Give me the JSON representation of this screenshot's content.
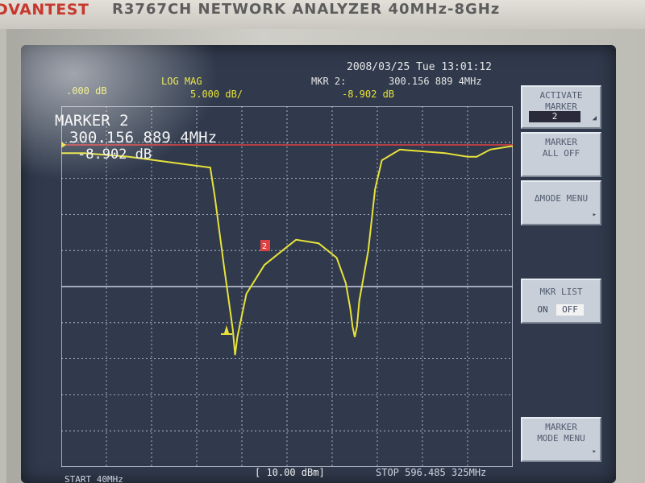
{
  "instrument": {
    "brand": "DVANTEST",
    "model": "R3767CH  NETWORK  ANALYZER  40MHz-8GHz"
  },
  "header": {
    "datetime": "2008/03/25 Tue 13:01:12",
    "format": "LOG MAG",
    "ref_value": ".000 dB",
    "scale": "5.000 dB/",
    "marker_label": "MKR  2:",
    "marker_freq": "300.156 889 4MHz",
    "marker_value": "-8.902 dB"
  },
  "marker_readout": {
    "title": "MARKER 2",
    "freq": "300.156  889  4MHz",
    "value": "-8.902 dB"
  },
  "trace_color": "#e8e23a",
  "grid_color": "#c9cfe0",
  "ref_line_color": "#e04040",
  "trace_norm": [
    [
      0,
      0.13
    ],
    [
      0.05,
      0.13
    ],
    [
      0.15,
      0.14
    ],
    [
      0.27,
      0.16
    ],
    [
      0.33,
      0.17
    ],
    [
      0.34,
      0.25
    ],
    [
      0.36,
      0.44
    ],
    [
      0.38,
      0.62
    ],
    [
      0.385,
      0.69
    ],
    [
      0.39,
      0.64
    ],
    [
      0.41,
      0.52
    ],
    [
      0.45,
      0.44
    ],
    [
      0.5,
      0.39
    ],
    [
      0.52,
      0.37
    ],
    [
      0.57,
      0.38
    ],
    [
      0.61,
      0.42
    ],
    [
      0.63,
      0.49
    ],
    [
      0.64,
      0.56
    ],
    [
      0.645,
      0.61
    ],
    [
      0.65,
      0.64
    ],
    [
      0.655,
      0.61
    ],
    [
      0.66,
      0.54
    ],
    [
      0.68,
      0.4
    ],
    [
      0.695,
      0.23
    ],
    [
      0.71,
      0.15
    ],
    [
      0.75,
      0.12
    ],
    [
      0.85,
      0.13
    ],
    [
      0.9,
      0.14
    ],
    [
      0.92,
      0.14
    ],
    [
      0.95,
      0.12
    ],
    [
      1,
      0.11
    ]
  ],
  "softkeys": {
    "activate_marker": {
      "label1": "ACTIVATE",
      "label2": "MARKER",
      "value": "2"
    },
    "marker_all_off": {
      "label1": "MARKER",
      "label2": "ALL OFF"
    },
    "delta_mode": {
      "label": "ΔMODE MENU"
    },
    "mkr_list": {
      "label": "MKR LIST",
      "on": "ON",
      "off": "OFF"
    },
    "mkr_mode": {
      "label1": "MARKER",
      "label2": "MODE MENU"
    }
  },
  "footer": {
    "start": "START 40MHz",
    "power": "[ 10.00 dBm]",
    "stop": "STOP 596.485 325MHz"
  }
}
